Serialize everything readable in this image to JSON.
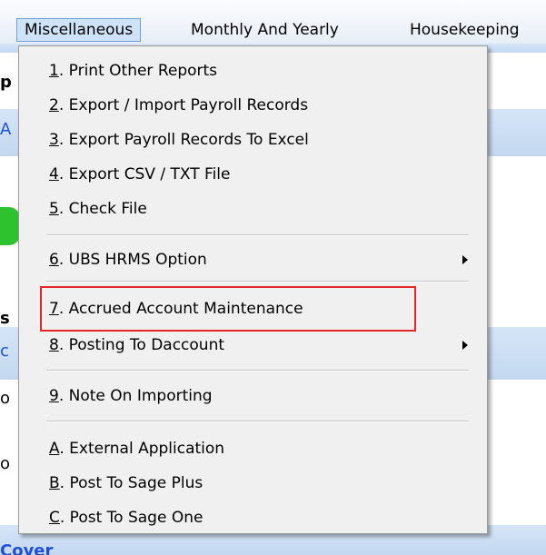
{
  "menubar": {
    "items": [
      {
        "label": "Miscellaneous"
      },
      {
        "label": "Monthly And Yearly"
      },
      {
        "label": "Housekeeping"
      }
    ]
  },
  "background": {
    "fragments": [
      "p",
      "A",
      "s",
      "c",
      "o",
      "o",
      "Cover"
    ]
  },
  "dropdown": {
    "items": [
      {
        "key": "1",
        "rest": ". Print Other Reports"
      },
      {
        "key": "2",
        "rest": ". Export / Import Payroll Records"
      },
      {
        "key": "3",
        "rest": ". Export Payroll Records To Excel"
      },
      {
        "key": "4",
        "rest": ". Export CSV / TXT File"
      },
      {
        "key": "5",
        "rest": ". Check File"
      },
      {
        "key": "6",
        "rest": ". UBS HRMS Option"
      },
      {
        "key": "7",
        "rest": ". Accrued Account Maintenance"
      },
      {
        "key": "8",
        "rest": ". Posting To Daccount"
      },
      {
        "key": "9",
        "rest": ". Note On Importing"
      },
      {
        "key": "A",
        "rest": ". External Application"
      },
      {
        "key": "B",
        "rest": ". Post To Sage Plus"
      },
      {
        "key": "C",
        "rest": ". Post To Sage One"
      }
    ]
  },
  "colors": {
    "highlight": "#e32626",
    "menu_bg": "#f0f0f0",
    "active_menubar": "#cfe3f8"
  }
}
